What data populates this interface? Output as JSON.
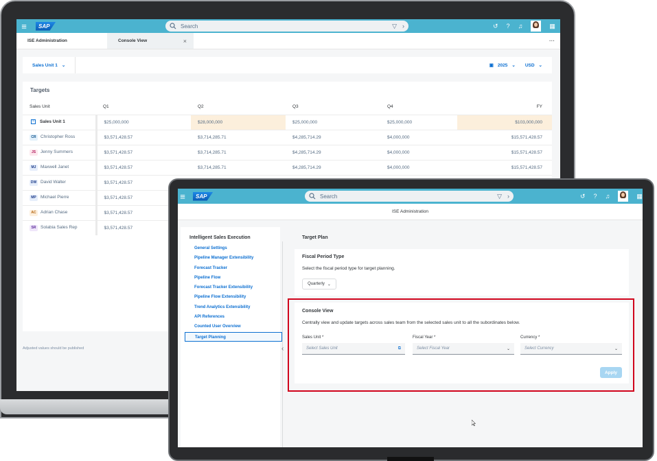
{
  "laptop": {
    "search_placeholder": "Search",
    "tabs": [
      {
        "label": "ISE Administration"
      },
      {
        "label": "Console View"
      }
    ],
    "tab_close": "×",
    "overflow": "···",
    "filter": {
      "sales_unit": "Sales Unit 1",
      "year": "2025",
      "currency": "USD"
    },
    "targets": {
      "title": "Targets",
      "columns": [
        "Sales Unit",
        "Q1",
        "Q2",
        "Q3",
        "Q4",
        "FY"
      ],
      "rows": [
        {
          "initials": "",
          "name": "Sales Unit 1",
          "q1": "$25,000,000",
          "q2": "$28,000,000",
          "q3": "$25,000,000",
          "q4": "$25,000,000",
          "fy": "$103,000,000"
        },
        {
          "initials": "CR",
          "name": "Christopher Ross",
          "q1": "$3,571,428.57",
          "q2": "$3,714,285.71",
          "q3": "$4,285,714.29",
          "q4": "$4,000,000",
          "fy": "$15,571,428.57"
        },
        {
          "initials": "JS",
          "name": "Jenny Summers",
          "q1": "$3,571,428.57",
          "q2": "$3,714,285.71",
          "q3": "$4,285,714.29",
          "q4": "$4,000,000",
          "fy": "$15,571,428.57"
        },
        {
          "initials": "MJ",
          "name": "Maxwell Janet",
          "q1": "$3,571,428.57",
          "q2": "$3,714,285.71",
          "q3": "$4,285,714.29",
          "q4": "$4,000,000",
          "fy": "$15,571,428.57"
        },
        {
          "initials": "DW",
          "name": "David Walter",
          "q1": "$3,571,428.57",
          "q2": "",
          "q3": "",
          "q4": "",
          "fy": ""
        },
        {
          "initials": "MP",
          "name": "Michael Pierre",
          "q1": "$3,571,428.57",
          "q2": "",
          "q3": "",
          "q4": "",
          "fy": ""
        },
        {
          "initials": "AC",
          "name": "Adrian Chase",
          "q1": "$3,571,428.57",
          "q2": "",
          "q3": "",
          "q4": "",
          "fy": ""
        },
        {
          "initials": "SR",
          "name": "Solabia Sales Rep",
          "q1": "$3,571,428.57",
          "q2": "",
          "q3": "",
          "q4": "",
          "fy": ""
        }
      ]
    },
    "footer_note": "Adjusted values should be published"
  },
  "tablet": {
    "search_placeholder": "Search",
    "page_title": "ISE Administration",
    "nav": {
      "title": "Intelligent Sales Execution",
      "items": [
        "General Settings",
        "Pipeline Manager Extensibility",
        "Forecast Tracker",
        "Pipeline Flow",
        "Forecast Tracker Extensibility",
        "Pipeline Flow Extensibility",
        "Trend Analytics Extensibility",
        "API References",
        "Counted User Overview",
        "Target Planning"
      ]
    },
    "collapse": "‹",
    "target_plan": {
      "title": "Target Plan",
      "fiscal": {
        "title": "Fiscal Period Type",
        "desc": "Select the fiscal period type for target planning.",
        "value": "Quarterly"
      },
      "console": {
        "title": "Console View",
        "desc": "Centrally view and update targets across sales team from the selected sales unit to all the subordinates below.",
        "sales_unit_label": "Sales Unit *",
        "sales_unit_placeholder": "Select Sales Unit",
        "fiscal_year_label": "Fiscal Year *",
        "fiscal_year_placeholder": "Select Fiscal Year",
        "currency_label": "Currency *",
        "currency_placeholder": "Select Currency",
        "apply": "Apply"
      }
    }
  },
  "colors": {
    "shell": "#4bb3cf",
    "link": "#0a6ed1",
    "highlight": "#fcefdc",
    "red_outline": "#d0021b"
  },
  "icons": [
    "menu-icon",
    "search-icon",
    "filter-icon",
    "history-icon",
    "help-icon",
    "bell-icon",
    "avatar",
    "grid-icon",
    "calendar-icon",
    "chevron-down-icon",
    "collapse-icon",
    "value-help-icon"
  ]
}
